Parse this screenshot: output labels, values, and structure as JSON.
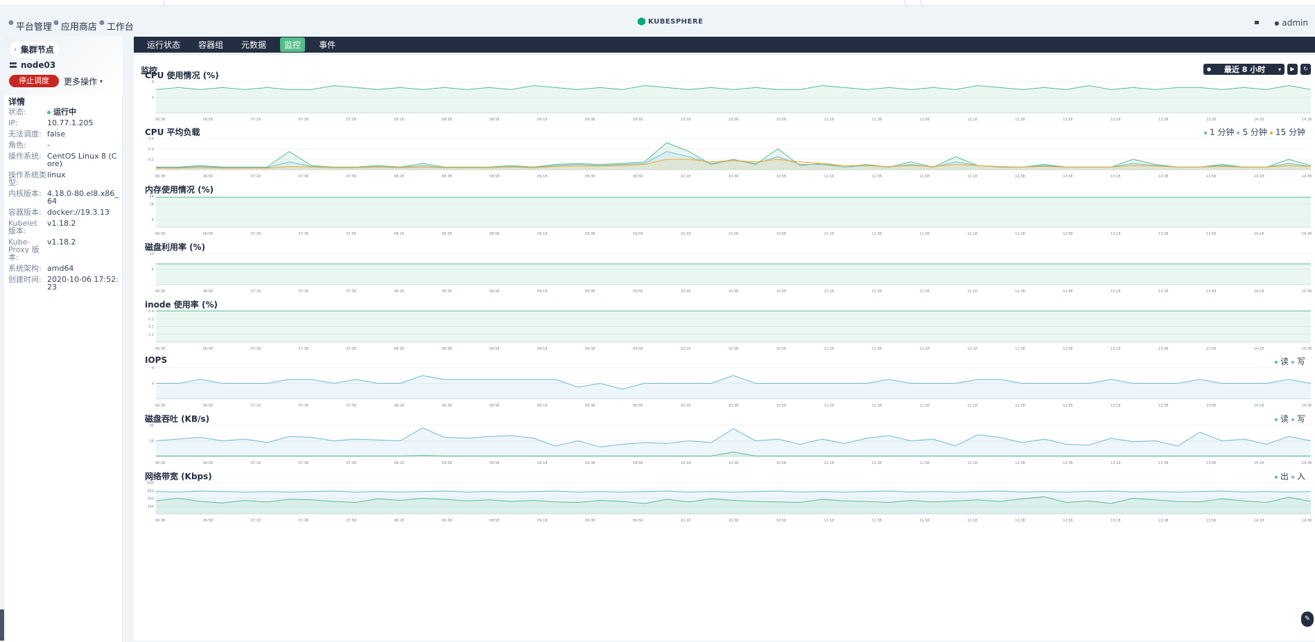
{
  "header": {
    "nav": [
      {
        "label": "平台管理",
        "icon": "platform-icon"
      },
      {
        "label": "应用商店",
        "icon": "store-icon"
      },
      {
        "label": "工作台",
        "icon": "workbench-icon"
      }
    ],
    "logo_text": "KUBESPHERE",
    "user": "admin"
  },
  "sidebar": {
    "back_label": "集群节点",
    "node_name": "node03",
    "stop_button": "停止调度",
    "more_button": "更多操作",
    "detail_title": "详情",
    "details": [
      {
        "k": "状态:",
        "v": "运行中"
      },
      {
        "k": "IP:",
        "v": "10.77.1.205"
      },
      {
        "k": "无法调度:",
        "v": "false"
      },
      {
        "k": "角色:",
        "v": "-"
      },
      {
        "k": "操作系统:",
        "v": "CentOS Linux 8 (Core)"
      },
      {
        "k": "操作系统类型:",
        "v": "linux"
      },
      {
        "k": "内核版本:",
        "v": "4.18.0-80.el8.x86_64"
      },
      {
        "k": "容器版本:",
        "v": "docker://19.3.13"
      },
      {
        "k": "Kubelet 版本:",
        "v": "v1.18.2"
      },
      {
        "k": "Kube-Proxy 版本:",
        "v": "v1.18.2"
      },
      {
        "k": "系统架构:",
        "v": "amd64"
      },
      {
        "k": "创建时间:",
        "v": "2020-10-06 17:52:23"
      }
    ]
  },
  "tabs": [
    {
      "label": "运行状态",
      "active": false
    },
    {
      "label": "容器组",
      "active": false
    },
    {
      "label": "元数据",
      "active": false
    },
    {
      "label": "监控",
      "active": true
    },
    {
      "label": "事件",
      "active": false
    }
  ],
  "monitor": {
    "title": "监控",
    "time_range": "最近 8 小时",
    "play_icon": "play-icon",
    "refresh_icon": "refresh-icon"
  },
  "colors": {
    "green": "#55bc8a",
    "blue": "#6fb7d8",
    "orange": "#f5a623",
    "dark": "#242e42"
  },
  "x_ticks": [
    "06:38",
    "06:58",
    "07:18",
    "07:38",
    "07:58",
    "08:18",
    "08:38",
    "08:58",
    "09:18",
    "09:38",
    "09:58",
    "10:18",
    "10:38",
    "10:58",
    "11:18",
    "11:38",
    "11:58",
    "12:18",
    "12:38",
    "12:58",
    "13:18",
    "13:38",
    "13:58",
    "14:18",
    "14:38"
  ],
  "chart_data": [
    {
      "type": "area",
      "title": "CPU 使用情况 (%)",
      "yticks": [
        "8",
        "4"
      ],
      "ylim": [
        0,
        8
      ],
      "series": [
        {
          "color": "#55bc8a",
          "values": [
            6,
            6.5,
            6,
            6.5,
            6,
            6.5,
            6,
            6,
            7,
            6.5,
            6,
            6.5,
            6,
            6.5,
            6,
            6.5,
            6,
            7,
            6.5,
            6,
            6.5,
            6,
            7,
            6.5,
            6,
            6.5,
            6,
            6.5,
            6,
            6,
            7,
            6.5,
            6,
            6.5,
            6,
            6.5,
            6,
            7,
            6.5,
            6,
            6.5,
            6,
            7,
            6,
            6.5,
            6,
            6.5,
            6.5,
            6,
            6.5,
            6,
            7,
            6
          ]
        }
      ]
    },
    {
      "type": "area",
      "title": "CPU 平均负载",
      "yticks": [
        "0.6",
        "0.4",
        "0.2"
      ],
      "ylim": [
        0,
        0.6
      ],
      "legend": [
        {
          "name": "1 分钟",
          "color": "#55bc8a"
        },
        {
          "name": "5 分钟",
          "color": "#6fb7d8"
        },
        {
          "name": "15 分钟",
          "color": "#f5a623"
        }
      ],
      "series": [
        {
          "color": "#55bc8a",
          "values": [
            0.05,
            0.05,
            0.08,
            0.05,
            0.05,
            0.05,
            0.35,
            0.08,
            0.05,
            0.05,
            0.08,
            0.05,
            0.12,
            0.05,
            0.05,
            0.05,
            0.08,
            0.05,
            0.1,
            0.12,
            0.1,
            0.12,
            0.15,
            0.52,
            0.35,
            0.1,
            0.2,
            0.1,
            0.4,
            0.08,
            0.12,
            0.05,
            0.1,
            0.05,
            0.15,
            0.05,
            0.25,
            0.08,
            0.05,
            0.05,
            0.1,
            0.05,
            0.05,
            0.05,
            0.2,
            0.1,
            0.05,
            0.05,
            0.1,
            0.05,
            0.05,
            0.2,
            0.08
          ]
        },
        {
          "color": "#6fb7d8",
          "values": [
            0.04,
            0.04,
            0.06,
            0.04,
            0.04,
            0.04,
            0.15,
            0.06,
            0.04,
            0.04,
            0.06,
            0.04,
            0.08,
            0.04,
            0.04,
            0.04,
            0.06,
            0.04,
            0.08,
            0.1,
            0.08,
            0.1,
            0.12,
            0.35,
            0.25,
            0.12,
            0.18,
            0.12,
            0.25,
            0.1,
            0.1,
            0.05,
            0.08,
            0.05,
            0.1,
            0.05,
            0.15,
            0.08,
            0.05,
            0.05,
            0.08,
            0.05,
            0.05,
            0.05,
            0.12,
            0.08,
            0.05,
            0.05,
            0.08,
            0.05,
            0.05,
            0.12,
            0.06
          ]
        },
        {
          "color": "#f5a623",
          "values": [
            0.03,
            0.03,
            0.04,
            0.03,
            0.03,
            0.03,
            0.06,
            0.05,
            0.04,
            0.04,
            0.05,
            0.04,
            0.05,
            0.04,
            0.04,
            0.04,
            0.05,
            0.04,
            0.06,
            0.07,
            0.07,
            0.08,
            0.1,
            0.2,
            0.2,
            0.15,
            0.18,
            0.15,
            0.2,
            0.15,
            0.12,
            0.08,
            0.08,
            0.06,
            0.08,
            0.06,
            0.1,
            0.08,
            0.06,
            0.05,
            0.06,
            0.05,
            0.05,
            0.05,
            0.08,
            0.07,
            0.05,
            0.05,
            0.06,
            0.05,
            0.05,
            0.08,
            0.06
          ]
        }
      ]
    },
    {
      "type": "area",
      "title": "内存使用情况 (%)",
      "yticks": [
        "24",
        "18",
        "6"
      ],
      "ylim": [
        0,
        24
      ],
      "series": [
        {
          "color": "#55bc8a",
          "values": [
            23,
            23,
            23,
            23,
            23,
            23,
            23,
            23,
            23,
            23,
            23,
            23,
            23,
            23,
            23,
            23,
            23,
            23,
            23,
            23,
            23,
            23,
            23,
            23,
            23,
            23,
            23,
            23,
            23,
            23,
            23,
            23,
            23,
            23,
            23,
            23,
            23,
            23,
            23,
            23,
            23,
            23,
            23,
            23,
            23,
            23,
            23,
            23,
            23,
            23,
            23,
            23,
            23
          ]
        }
      ]
    },
    {
      "type": "area",
      "title": "磁盘利用率 (%)",
      "yticks": [
        "12",
        "6"
      ],
      "ylim": [
        0,
        12
      ],
      "series": [
        {
          "color": "#55bc8a",
          "values": [
            8,
            8,
            8,
            8,
            8,
            8,
            8,
            8,
            8,
            8,
            8,
            8,
            8,
            8,
            8,
            8,
            8,
            8,
            8,
            8,
            8,
            8,
            8,
            8,
            8,
            8,
            8,
            8,
            8,
            8,
            8,
            8,
            8,
            8,
            8,
            8,
            8,
            8,
            8,
            8,
            8,
            8,
            8,
            8,
            8,
            8,
            8,
            8,
            8,
            8,
            8,
            8,
            8
          ]
        }
      ]
    },
    {
      "type": "area",
      "title": "inode 使用率 (%)",
      "yticks": [
        "0.4",
        "0.3",
        "0.2",
        "0.1"
      ],
      "ylim": [
        0,
        0.4
      ],
      "series": [
        {
          "color": "#55bc8a",
          "values": [
            0.4,
            0.4,
            0.4,
            0.4,
            0.4,
            0.4,
            0.4,
            0.4,
            0.4,
            0.4,
            0.4,
            0.4,
            0.4,
            0.4,
            0.4,
            0.4,
            0.4,
            0.4,
            0.4,
            0.4,
            0.4,
            0.4,
            0.4,
            0.4,
            0.4,
            0.4,
            0.4,
            0.4,
            0.4,
            0.4,
            0.4,
            0.4,
            0.4,
            0.4,
            0.4,
            0.4,
            0.4,
            0.4,
            0.4,
            0.4,
            0.4,
            0.4,
            0.4,
            0.4,
            0.4,
            0.4,
            0.4,
            0.4,
            0.4,
            0.4,
            0.4,
            0.4,
            0.4
          ]
        }
      ]
    },
    {
      "type": "area",
      "title": "IOPS",
      "yticks": [
        "8",
        "4"
      ],
      "ylim": [
        0,
        8
      ],
      "legend": [
        {
          "name": "读",
          "color": "#55bc8a"
        },
        {
          "name": "写",
          "color": "#6fb7d8"
        }
      ],
      "series": [
        {
          "color": "#6fb7d8",
          "values": [
            4,
            4,
            5,
            4,
            4,
            4,
            5,
            5,
            4,
            5,
            4,
            4,
            6,
            5,
            5,
            5,
            5,
            5,
            5,
            3,
            4,
            2.5,
            4,
            4,
            4,
            4,
            6,
            4,
            4,
            4,
            4,
            4,
            4,
            5,
            4,
            4,
            4,
            5,
            5,
            4,
            4,
            4,
            4,
            5,
            4,
            4,
            4,
            5,
            4,
            4,
            4,
            5,
            4
          ]
        }
      ]
    },
    {
      "type": "area",
      "title": "磁盘吞吐 (KB/s)",
      "yticks": [
        "36",
        "18"
      ],
      "ylim": [
        0,
        36
      ],
      "legend": [
        {
          "name": "读",
          "color": "#55bc8a"
        },
        {
          "name": "写",
          "color": "#6fb7d8"
        }
      ],
      "series": [
        {
          "color": "#6fb7d8",
          "values": [
            18,
            20,
            22,
            18,
            20,
            16,
            23,
            22,
            18,
            20,
            19,
            18,
            33,
            22,
            21,
            23,
            24,
            21,
            12,
            18,
            11,
            14,
            16,
            15,
            18,
            16,
            32,
            18,
            20,
            14,
            20,
            15,
            21,
            24,
            18,
            20,
            12,
            25,
            22,
            16,
            20,
            14,
            13,
            21,
            17,
            18,
            12,
            28,
            18,
            20,
            14,
            23,
            18
          ]
        },
        {
          "color": "#55bc8a",
          "values": [
            0.5,
            0.5,
            0.5,
            0.5,
            0.5,
            0.5,
            0.5,
            0.5,
            0.5,
            0.5,
            0.5,
            0.5,
            1,
            0.5,
            0.5,
            0.5,
            0.5,
            0.5,
            0.5,
            0.5,
            0.5,
            0.5,
            0.5,
            0.5,
            0.5,
            0.5,
            5,
            0.5,
            0.5,
            0.5,
            0.5,
            0.5,
            0.5,
            0.5,
            0.5,
            0.5,
            0.5,
            0.5,
            0.5,
            0.5,
            0.5,
            0.5,
            0.5,
            0.5,
            0.5,
            0.5,
            0.5,
            0.5,
            0.5,
            0.5,
            0.5,
            0.5,
            0.5
          ]
        }
      ]
    },
    {
      "type": "area",
      "title": "网络带宽 (Kbps)",
      "yticks": [
        "600",
        "450",
        "300",
        "150"
      ],
      "ylim": [
        0,
        600
      ],
      "legend": [
        {
          "name": "出",
          "color": "#55bc8a"
        },
        {
          "name": "入",
          "color": "#6fb7d8"
        }
      ],
      "series": [
        {
          "color": "#6fb7d8",
          "values": [
            430,
            420,
            440,
            430,
            420,
            430,
            420,
            430,
            440,
            420,
            430,
            420,
            430,
            440,
            420,
            430,
            420,
            430,
            440,
            420,
            430,
            420,
            430,
            440,
            420,
            430,
            420,
            430,
            440,
            420,
            430,
            420,
            430,
            440,
            420,
            430,
            420,
            430,
            440,
            420,
            430,
            420,
            430,
            440,
            420,
            430,
            420,
            430,
            440,
            420,
            430,
            420,
            430
          ]
        },
        {
          "color": "#55bc8a",
          "values": [
            250,
            300,
            240,
            210,
            260,
            230,
            280,
            270,
            240,
            220,
            290,
            260,
            300,
            280,
            250,
            270,
            240,
            260,
            230,
            220,
            260,
            240,
            200,
            280,
            230,
            290,
            260,
            240,
            230,
            220,
            280,
            250,
            240,
            220,
            260,
            230,
            250,
            270,
            240,
            290,
            330,
            220,
            250,
            200,
            300,
            270,
            240,
            230,
            290,
            250,
            220,
            320,
            240
          ]
        }
      ]
    }
  ],
  "fab_icon": "edit-icon"
}
